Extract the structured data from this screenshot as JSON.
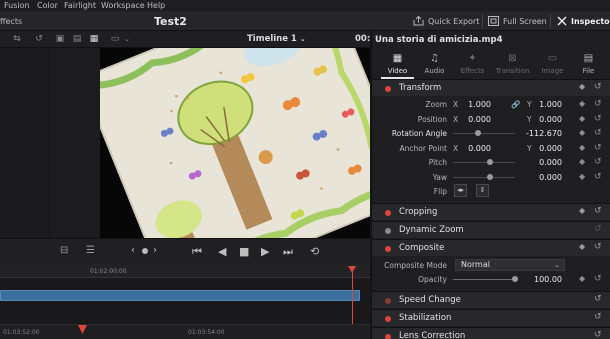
{
  "menu": {
    "items": [
      "Fusion",
      "Color",
      "Fairlight",
      "Workspace",
      "Help"
    ]
  },
  "header": {
    "left_label": "ffects",
    "project_title": "Test2",
    "quick_export_label": "Quick Export",
    "full_screen_label": "Full Screen",
    "inspector_label": "Inspector"
  },
  "viewer_toolbar": {
    "timeline_name": "Timeline 1",
    "timecode": "00:"
  },
  "inspector": {
    "clip_name": "Una storia di amicizia.mp4",
    "tabs": [
      {
        "label": "Video",
        "icon": "film-icon",
        "state": "active"
      },
      {
        "label": "Audio",
        "icon": "music-note-icon",
        "state": "enabled"
      },
      {
        "label": "Effects",
        "icon": "magic-wand-icon",
        "state": "disabled"
      },
      {
        "label": "Transition",
        "icon": "transition-icon",
        "state": "disabled"
      },
      {
        "label": "Image",
        "icon": "image-icon",
        "state": "disabled"
      },
      {
        "label": "File",
        "icon": "file-icon",
        "state": "enabled"
      }
    ],
    "transform": {
      "title": "Transform",
      "zoom_label": "Zoom",
      "zoom_x": "1.000",
      "zoom_y": "1.000",
      "position_label": "Position",
      "position_x": "0.000",
      "position_y": "0.000",
      "rotation_label": "Rotation Angle",
      "rotation_value": "-112.670",
      "anchor_label": "Anchor Point",
      "anchor_x": "0.000",
      "anchor_y": "0.000",
      "pitch_label": "Pitch",
      "pitch_value": "0.000",
      "yaw_label": "Yaw",
      "yaw_value": "0.000",
      "flip_label": "Flip",
      "x_axis": "X",
      "y_axis": "Y"
    },
    "cropping": {
      "title": "Cropping"
    },
    "dynamic_zoom": {
      "title": "Dynamic Zoom"
    },
    "composite": {
      "title": "Composite",
      "mode_label": "Composite Mode",
      "mode_value": "Normal",
      "opacity_label": "Opacity",
      "opacity_value": "100.00"
    },
    "speed_change": {
      "title": "Speed Change"
    },
    "stabilization": {
      "title": "Stabilization"
    },
    "lens_correction": {
      "title": "Lens Correction"
    }
  },
  "timeline": {
    "ruler_marks": [
      "01:02:00:00"
    ],
    "bottom_ruler_marks": [
      "01:03:52:00",
      "01:03:54:00"
    ]
  },
  "colors": {
    "accent_red": "#e0443a",
    "clip_blue": "#3d6f9c",
    "panel": "#1f1f22"
  }
}
